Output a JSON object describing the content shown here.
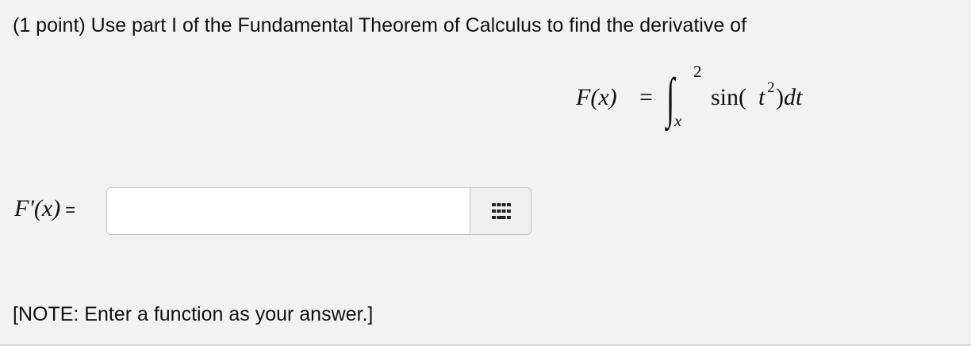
{
  "problem": {
    "prompt": "(1 point) Use part I of the Fundamental Theorem of Calculus to find the derivative of"
  },
  "formula": {
    "lhs": "F(x)",
    "equals": "=",
    "integral_sign": "∫",
    "upper_limit": "2",
    "lower_limit": "x",
    "function_name": "sin(",
    "variable": "t",
    "exponent": "2",
    "close_paren": ")",
    "differential": "dt"
  },
  "answer": {
    "label": "F′(x)",
    "equals": "=",
    "value": "",
    "placeholder": "",
    "palette_icon": "equation-palette-icon"
  },
  "note": "[NOTE: Enter a function as your answer.]",
  "colors": {
    "background": "#f2f2f2",
    "input_border": "#c4c4c4",
    "palette_bg": "#efefef",
    "icon": "#222222"
  }
}
